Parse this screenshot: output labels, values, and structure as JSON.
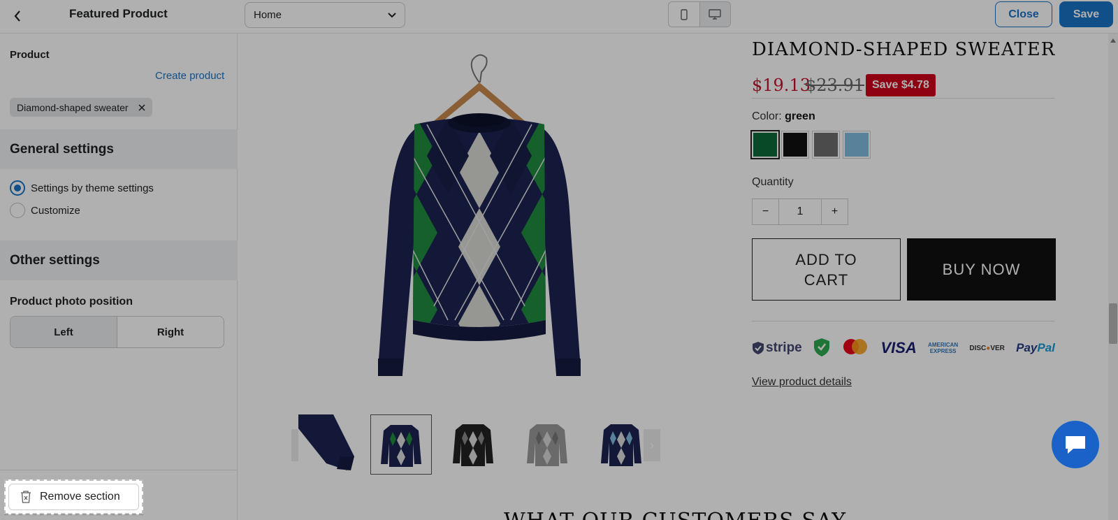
{
  "topbar": {
    "title": "Featured Product",
    "page_select_value": "Home",
    "close_label": "Close",
    "save_label": "Save"
  },
  "sidebar": {
    "product_label": "Product",
    "create_product_link": "Create product",
    "selected_product_chip": "Diamond-shaped sweater",
    "general_settings_heading": "General settings",
    "radio_options": [
      "Settings by theme settings",
      "Customize"
    ],
    "radio_selected": "Settings by theme settings",
    "other_settings_heading": "Other settings",
    "photo_position_label": "Product photo position",
    "photo_position_options": [
      "Left",
      "Right"
    ],
    "photo_position_selected": "Left",
    "remove_section_label": "Remove section"
  },
  "preview": {
    "product_title": "DIAMOND-SHAPED SWEATER",
    "price": "$19.13",
    "compare_price": "$23.91",
    "save_badge": "Save $4.78",
    "color_label": "Color:",
    "color_value": "green",
    "swatches": [
      {
        "name": "green",
        "hex": "#0d6b3a"
      },
      {
        "name": "black",
        "hex": "#111111"
      },
      {
        "name": "gray",
        "hex": "#6d6d6d"
      },
      {
        "name": "light blue",
        "hex": "#7fbde0"
      }
    ],
    "quantity_label": "Quantity",
    "quantity_value": "1",
    "qty_minus": "−",
    "qty_plus": "+",
    "add_to_cart_label": "ADD TO CART",
    "buy_now_label": "BUY NOW",
    "payment_logos": [
      "stripe",
      "secure-badge",
      "mastercard",
      "VISA",
      "American Express",
      "DISCOVER",
      "PayPal"
    ],
    "view_details_link": "View product details",
    "section_heading": "WHAT OUR CUSTOMERS SAY"
  },
  "colors": {
    "accent": "#1a73c7",
    "sale_red": "#d0021b",
    "chat_blue": "#1a62c7"
  }
}
